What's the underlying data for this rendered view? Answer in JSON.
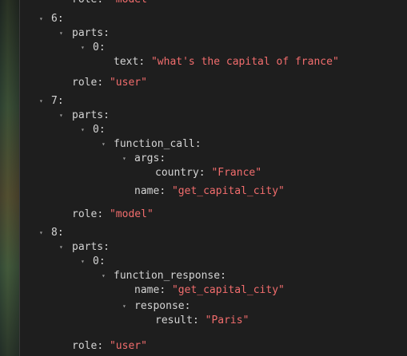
{
  "tree": {
    "twisty": "▾",
    "quote": "\"",
    "colon": ":",
    "top_role_key": "role",
    "top_role_value": "model",
    "items": [
      {
        "index": "6",
        "parts_key": "parts",
        "part_index": "0",
        "text_key": "text",
        "text_value": "what's the capital of france",
        "role_key": "role",
        "role_value": "user"
      },
      {
        "index": "7",
        "parts_key": "parts",
        "part_index": "0",
        "fc_key": "function_call",
        "args_key": "args",
        "country_key": "country",
        "country_value": "France",
        "name_key": "name",
        "name_value": "get_capital_city",
        "role_key": "role",
        "role_value": "model"
      },
      {
        "index": "8",
        "parts_key": "parts",
        "part_index": "0",
        "fr_key": "function_response",
        "name_key": "name",
        "name_value": "get_capital_city",
        "response_key": "response",
        "result_key": "result",
        "result_value": "Paris",
        "role_key": "role",
        "role_value": "user"
      }
    ]
  },
  "colors": {
    "background": "#1e1e1e",
    "key": "#d4d4d4",
    "string": "#f26d6d",
    "twisty": "#9a9a9a"
  }
}
